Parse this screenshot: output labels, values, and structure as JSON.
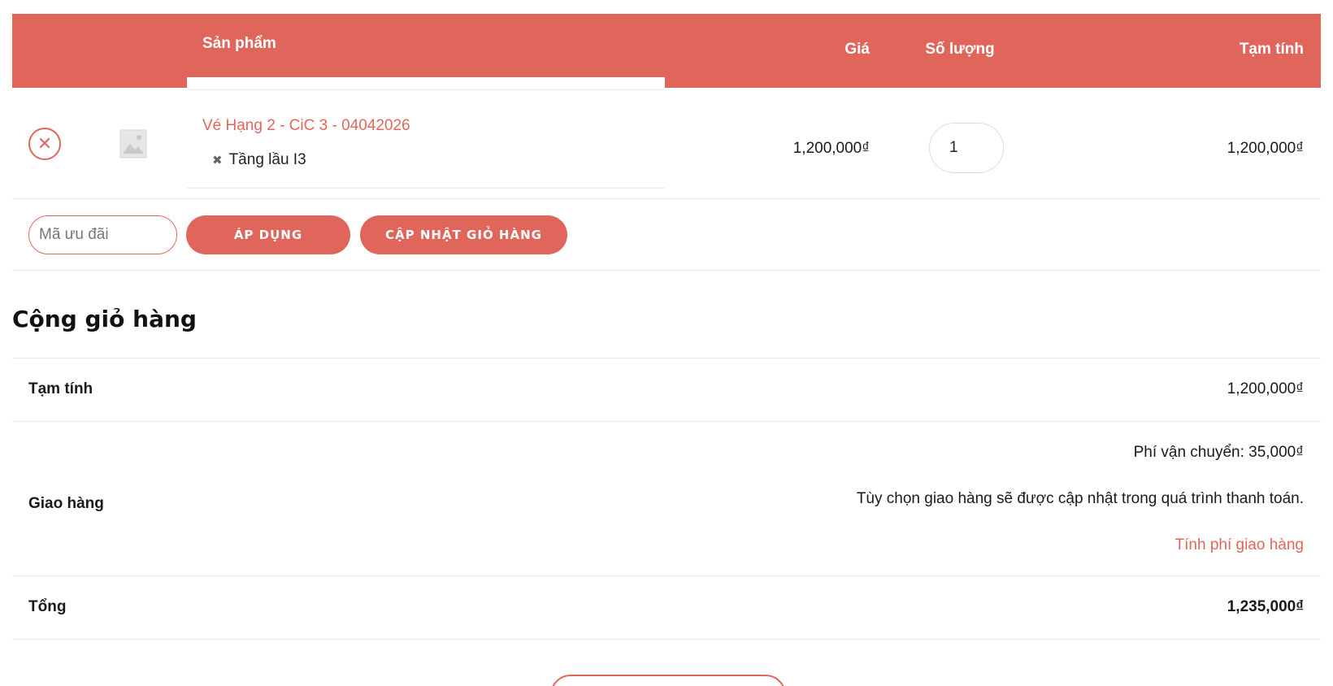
{
  "cart": {
    "headers": {
      "product": "Sản phẩm",
      "price": "Giá",
      "quantity": "Số lượng",
      "subtotal": "Tạm tính"
    },
    "item": {
      "name": "Vé Hạng 2 - CiC 3 - 04042026",
      "variant": "Tầng lầu I3",
      "price": "1,200,000₫",
      "quantity": "1",
      "subtotal": "1,200,000₫"
    },
    "coupon_placeholder": "Mã ưu đãi",
    "apply_label": "ÁP DỤNG",
    "update_label": "CẬP NHẬT GIỎ HÀNG"
  },
  "totals": {
    "title": "Cộng giỏ hàng",
    "subtotal_label": "Tạm tính",
    "subtotal_value": "1,200,000₫",
    "shipping_label": "Giao hàng",
    "shipping_fee": "Phí vận chuyển: 35,000₫",
    "shipping_note": "Tùy chọn giao hàng sẽ được cập nhật trong quá trình thanh toán.",
    "shipping_calc": "Tính phí giao hàng",
    "total_label": "Tổng",
    "total_value": "1,235,000₫"
  },
  "colors": {
    "accent": "#e0665b",
    "border": "#ececec"
  },
  "icons": {
    "remove": "close-icon",
    "thumbnail": "image-placeholder-icon"
  }
}
